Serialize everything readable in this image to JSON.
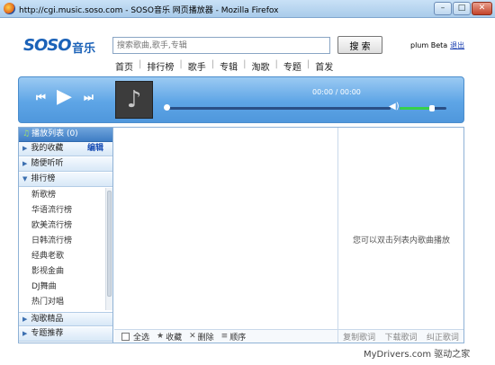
{
  "window": {
    "title": "http://cgi.music.soso.com - SOSO音乐 网页播放器 - Mozilla Firefox",
    "minimize": "–",
    "maximize": "□",
    "close": "✕"
  },
  "logo": {
    "brand": "SOSO",
    "suffix": "音乐"
  },
  "search": {
    "placeholder": "搜索歌曲,歌手,专辑",
    "button": "搜 索"
  },
  "user": {
    "name": "plum Beta",
    "logout": "退出"
  },
  "nav": [
    "首页",
    "排行榜",
    "歌手",
    "专辑",
    "淘歌",
    "专题",
    "首发"
  ],
  "player": {
    "time": "00:00 / 00:00",
    "progress": 0,
    "volume": 0.7,
    "icons": {
      "prev": "prev-icon",
      "play": "play-icon",
      "next": "next-icon",
      "cover": "music-note-icon",
      "volume": "speaker-icon"
    }
  },
  "sidebar": {
    "playlist": "播放列表 (0)",
    "favorites": "我的收藏",
    "edit": "编辑",
    "random": "随便听听",
    "charts": "排行榜",
    "chart_items": [
      "新歌榜",
      "华语流行榜",
      "欧美流行榜",
      "日韩流行榜",
      "经典老歌",
      "影视金曲",
      "DJ舞曲",
      "热门对唱"
    ],
    "boutique": "淘歌精品",
    "topics": "专题推荐"
  },
  "list_tools": {
    "select_all": "全选",
    "favorite": "收藏",
    "delete": "删除",
    "order": "顺序"
  },
  "lyrics": {
    "hint": "您可以双击列表内歌曲播放",
    "copy": "复制歌词",
    "download": "下载歌词",
    "correct": "纠正歌词"
  },
  "watermark": "MyDrivers.com 驱动之家"
}
